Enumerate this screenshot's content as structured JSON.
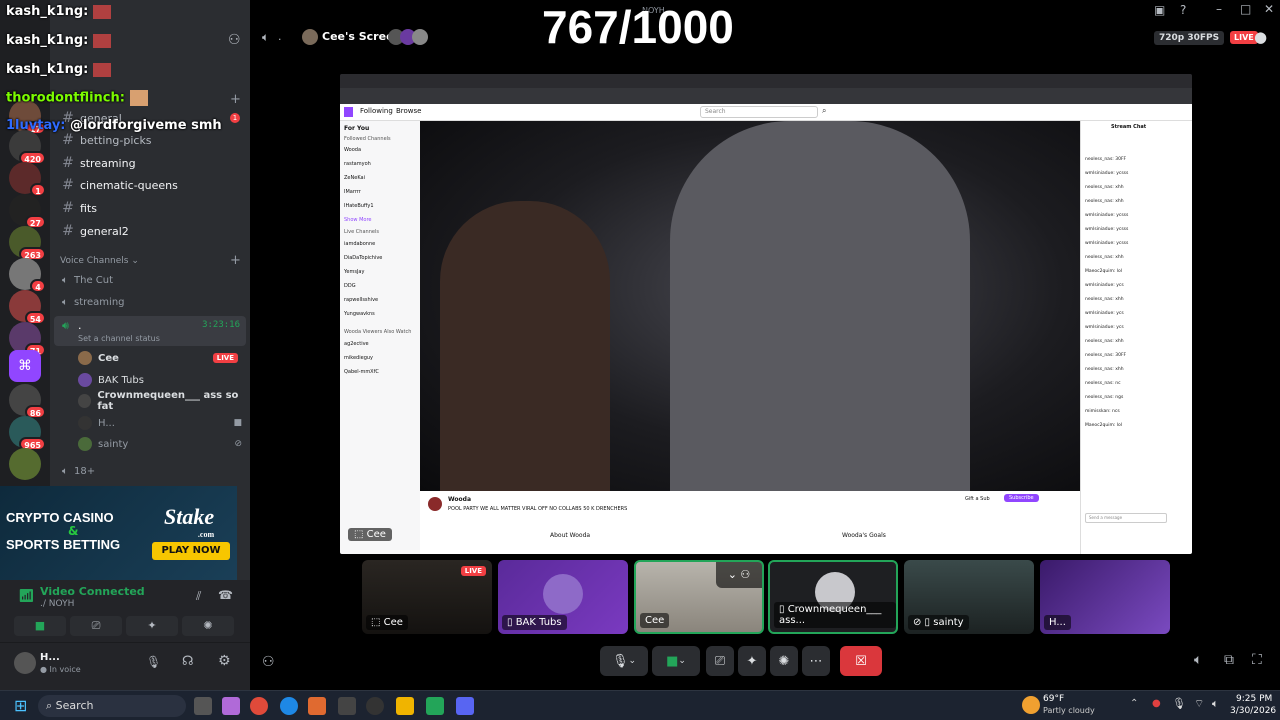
{
  "overlay": {
    "counter": "767/1000",
    "chat": [
      {
        "user": "kash_k1ng:",
        "msg": "",
        "color": "#ffffff"
      },
      {
        "user": "kash_k1ng:",
        "msg": "",
        "color": "#ffffff"
      },
      {
        "user": "kash_k1ng:",
        "msg": "",
        "color": "#ffffff"
      },
      {
        "user": "thorodontflinch:",
        "msg": "",
        "color": "#7cfc00"
      },
      {
        "user": "1luvtay:",
        "msg": "@lordforgiveme smh",
        "color": "#2f6bff"
      }
    ]
  },
  "rail": {
    "badges": [
      "17",
      "420",
      "1",
      "27",
      "263",
      "4",
      "54",
      "71",
      "86",
      "965"
    ]
  },
  "sidebar": {
    "text_channels": [
      "general",
      "betting-picks",
      "streaming",
      "cinematic-queens",
      "fits",
      "general2"
    ],
    "voice_header": "Voice Channels",
    "voice_channels": [
      "The Cut",
      "streaming"
    ],
    "active_voice": {
      "name": ".",
      "timer": "3:23:16",
      "status_placeholder": "Set a channel status"
    },
    "members": [
      {
        "name": "Cee",
        "live": "LIVE"
      },
      {
        "name": "BAK Tubs",
        "live": ""
      },
      {
        "name": "Crownmequeen___ ass so fat",
        "live": ""
      },
      {
        "name": "H...",
        "live": ""
      },
      {
        "name": "sainty",
        "live": ""
      }
    ],
    "extra_channel": "18+",
    "ad": {
      "line1": "CRYPTO CASINO",
      "amp": "&",
      "line2": "SPORTS BETTING",
      "brand": "Stake",
      "brand_sub": ".com",
      "cta": "PLAY NOW"
    },
    "voice_panel": {
      "status": "Video Connected",
      "path": "./ NOYH"
    },
    "user_panel": {
      "name": "H...",
      "status": "In voice"
    }
  },
  "stage": {
    "header": {
      "channel": ".",
      "title": "Cee's Screen",
      "quality": "720p 30FPS",
      "live": "LIVE",
      "server_label": "NOYH"
    },
    "shared": {
      "nav_following": "Following",
      "nav_browse": "Browse",
      "search_placeholder": "Search",
      "left_heading": "For You",
      "left_sub": "Followed Channels",
      "followed": [
        "Wooda",
        "rastamyoh",
        "ZeNeKai",
        "IMarrrr",
        "IHateBuffy1"
      ],
      "live_heading": "Live Channels",
      "live_channels": [
        "iamdabonne",
        "DiaDaTopichive",
        "YemsJay",
        "DDG",
        "rapwelIsshive",
        "Yungwavkns"
      ],
      "viewers_heading": "Wooda Viewers Also Watch",
      "also_watch": [
        "ag2ective",
        "mikedieguy",
        "Qabel-mmXfC"
      ],
      "show_more": "Show More",
      "chat_title": "Stream Chat",
      "chat_lines": [
        "neoless_nas: 30FF",
        "wmlsiniadue: ycsss",
        "neoless_nas: xhh",
        "neoless_nas: xhh",
        "wmlsiniadue: ycsss",
        "wmlsiniadue: ycsss",
        "wmlsiniadue: ycsss",
        "neoless_nas: xhh",
        "Maeoc2quim: lol",
        "wmlsiniadue: ycs",
        "neoless_nas: xhh",
        "wmlsiniadue: ycs",
        "wmlsiniadue: ycs",
        "neoless_nas: xhh",
        "neoless_nas: 30FF",
        "neoless_nas: xhh",
        "neoless_nas: nc",
        "neoless_nas: ngs",
        "mimisskan: ncs",
        "Maeoc2quim: lol"
      ],
      "chat_input": "Send a message",
      "streamer": "Wooda",
      "stream_title": "POOL PARTY WE ALL MATTER VIRAL OFF NO COLLABS 50 K DRENCHERS",
      "about": "About Wooda",
      "goals": "Wooda's Goals",
      "follow": "Subscribe",
      "gift": "Gift a Sub",
      "presenter_tag": "Cee"
    },
    "tiles": [
      {
        "name": "Cee",
        "live": "LIVE"
      },
      {
        "name": "BAK Tubs",
        "live": ""
      },
      {
        "name": "Cee",
        "live": ""
      },
      {
        "name": "Crownmequeen___ ass...",
        "live": ""
      },
      {
        "name": "sainty",
        "live": ""
      },
      {
        "name": "H...",
        "live": ""
      }
    ]
  },
  "taskbar": {
    "search": "Search",
    "weather_temp": "69°F",
    "weather_desc": "Partly cloudy",
    "time": "9:25 PM",
    "date": "3/30/2026"
  }
}
